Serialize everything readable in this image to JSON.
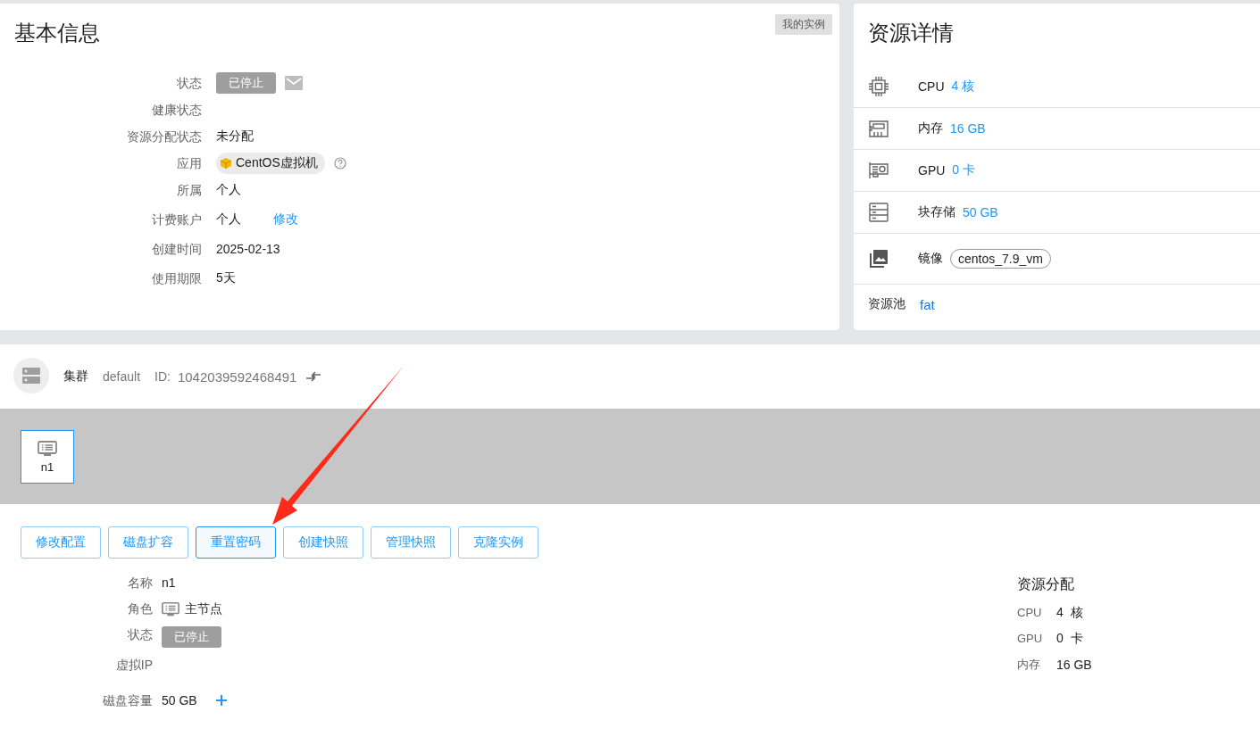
{
  "basic_info": {
    "title": "基本信息",
    "badge": "我的实例",
    "fields": [
      {
        "kind": "status",
        "label": "状态",
        "value": "已停止"
      },
      {
        "kind": "text",
        "label": "健康状态"
      },
      {
        "kind": "text",
        "label": "资源分配状态",
        "value": "未分配"
      },
      {
        "kind": "app",
        "label": "应用",
        "value": "CentOS虚拟机"
      },
      {
        "kind": "text",
        "label": "所属",
        "value": "个人"
      },
      {
        "kind": "link",
        "label": "计费账户",
        "value": "个人",
        "link": "修改"
      },
      {
        "kind": "text",
        "label": "创建时间",
        "value": "2025-02-13"
      },
      {
        "kind": "text",
        "label": "使用期限",
        "value": "5天"
      }
    ]
  },
  "resource_details": {
    "title": "资源详情",
    "items": [
      {
        "kind": "cpu",
        "label": "CPU",
        "value": "4 核"
      },
      {
        "kind": "memory",
        "label": "内存",
        "value": "16 GB"
      },
      {
        "kind": "gpu",
        "label": "GPU",
        "value": "0 卡"
      },
      {
        "kind": "storage",
        "label": "块存储",
        "value": "50 GB"
      },
      {
        "kind": "image",
        "label": "镜像",
        "value": "centos_7.9_vm"
      }
    ],
    "pool": {
      "label": "资源池",
      "value": "fat"
    }
  },
  "cluster": {
    "label": "集群",
    "name": "default",
    "id_label": "ID:",
    "id": "1042039592468491"
  },
  "nodes": [
    {
      "name": "n1",
      "selected": true
    }
  ],
  "actions": [
    {
      "label": "修改配置",
      "focused": false
    },
    {
      "label": "磁盘扩容",
      "focused": false
    },
    {
      "label": "重置密码",
      "focused": true
    },
    {
      "label": "创建快照",
      "focused": false
    },
    {
      "label": "管理快照",
      "focused": false
    },
    {
      "label": "克隆实例",
      "focused": false
    }
  ],
  "node_details": [
    {
      "kind": "text",
      "label": "名称",
      "value": "n1"
    },
    {
      "kind": "role",
      "label": "角色",
      "value": "主节点"
    },
    {
      "kind": "status",
      "label": "状态",
      "value": "已停止"
    },
    {
      "kind": "text",
      "label": "虚拟IP"
    },
    {
      "kind": "disk",
      "label": "磁盘容量",
      "value": "50 GB"
    }
  ],
  "allocation": {
    "title": "资源分配",
    "rows": [
      {
        "label": "CPU",
        "value": "4  核"
      },
      {
        "label": "GPU",
        "value": "0  卡"
      },
      {
        "label": "内存",
        "value": "16 GB"
      }
    ]
  }
}
